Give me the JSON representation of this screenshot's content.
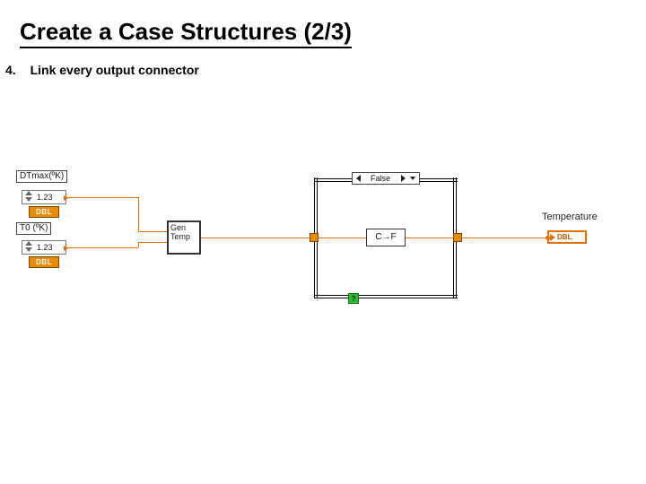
{
  "title": "Create a Case Structures (2/3)",
  "step": {
    "number": "4.",
    "text": "Link every output connector"
  },
  "controls": {
    "dtmax": {
      "label": "DTmax(ºK)",
      "value": "1.23",
      "type_badge": "DBL"
    },
    "t0": {
      "label": "T0 (ºK)",
      "value": "1.23",
      "type_badge": "DBL"
    }
  },
  "subvi": {
    "label": "Gen Temp"
  },
  "case_structure": {
    "selector": "False",
    "func_label": "C→F"
  },
  "indicator": {
    "label": "Temperature",
    "type_badge": "DBL"
  },
  "icons": {
    "help": "?",
    "arrow_left": "left",
    "arrow_right": "right",
    "dropdown": "down"
  }
}
